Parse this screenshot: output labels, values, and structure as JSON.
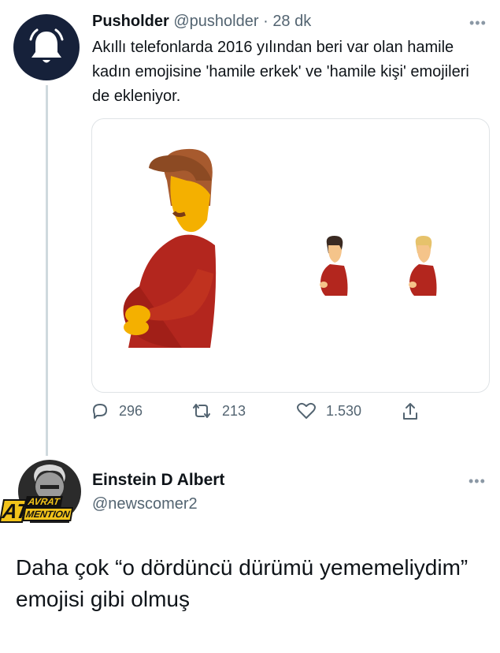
{
  "tweet1": {
    "display_name": "Pusholder",
    "handle": "@pusholder",
    "separator": "·",
    "time": "28 dk",
    "text": "Akıllı telefonlarda 2016 yılından beri var olan hamile kadın emojisine 'hamile erkek' ve 'hamile kişi' emojileri de ekleniyor.",
    "more_icon": "more-dots-icon",
    "stats": {
      "replies": "296",
      "retweets": "213",
      "likes": "1.530"
    },
    "icons": [
      "bell-icon",
      "reply-icon",
      "retweet-icon",
      "like-icon",
      "share-icon"
    ],
    "media_description_colors": {
      "shirt": "#b22b1d",
      "skin": "#f4b400",
      "hair": "#8c4f2a"
    }
  },
  "tweet2": {
    "display_name": "Einstein D Albert",
    "handle": "@newscomer2",
    "avatar_badge_line1": "AVRAT",
    "avatar_badge_line2": "MENTION",
    "avatar_badge_prefix": "AT",
    "text": "Daha çok “o dördüncü dürümü yememeliydim” emojisi gibi olmuş"
  },
  "colors": {
    "muted": "#536471",
    "line": "#cfd9de",
    "avatar_bg": "#16213a"
  }
}
